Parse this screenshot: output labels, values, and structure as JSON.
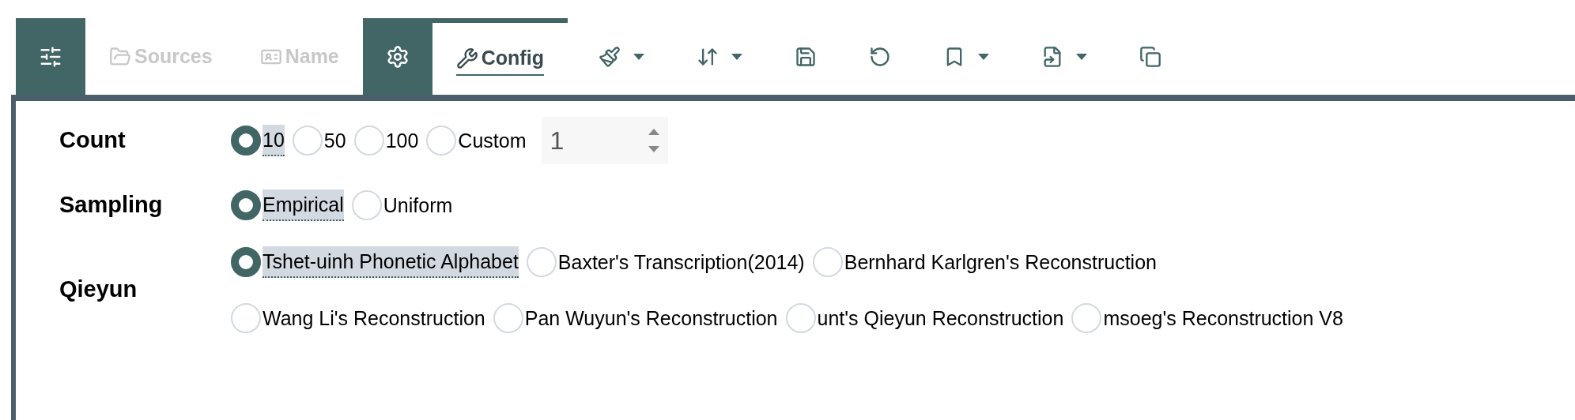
{
  "tabs": [
    {
      "kind": "icon-toggle",
      "on": true
    },
    {
      "kind": "tab",
      "label": "Sources",
      "disabled": true,
      "selected": false
    },
    {
      "kind": "tab",
      "label": "Name",
      "disabled": true,
      "selected": false
    },
    {
      "kind": "icon-toggle",
      "on": true
    },
    {
      "kind": "tab",
      "label": "Config",
      "disabled": false,
      "selected": true
    }
  ],
  "tools": [
    {
      "has_menu": true
    },
    {
      "has_menu": true
    },
    {
      "has_menu": false
    },
    {
      "has_menu": false
    },
    {
      "has_menu": true
    },
    {
      "has_menu": true
    },
    {
      "has_menu": false
    }
  ],
  "settings": [
    {
      "label": "Count",
      "options": [
        {
          "label": "10",
          "selected": true
        },
        {
          "label": "50",
          "selected": false
        },
        {
          "label": "100",
          "selected": false
        },
        {
          "label": "Custom",
          "selected": false
        }
      ],
      "custom_value": "1"
    },
    {
      "label": "Sampling",
      "options": [
        {
          "label": "Empirical",
          "selected": true
        },
        {
          "label": "Uniform",
          "selected": false
        }
      ]
    },
    {
      "label": "Qieyun",
      "options": [
        {
          "label": "Tshet-uinh Phonetic Alphabet",
          "selected": true
        },
        {
          "label": "Baxter's Transcription(2014)",
          "selected": false
        },
        {
          "label": "Bernhard Karlgren's Reconstruction",
          "selected": false
        },
        {
          "label": "Wang Li's Reconstruction",
          "selected": false
        },
        {
          "label": "Pan Wuyun's Reconstruction",
          "selected": false
        },
        {
          "label": "unt's Qieyun Reconstruction",
          "selected": false
        },
        {
          "label": "msoeg's Reconstruction V8",
          "selected": false
        }
      ]
    }
  ]
}
